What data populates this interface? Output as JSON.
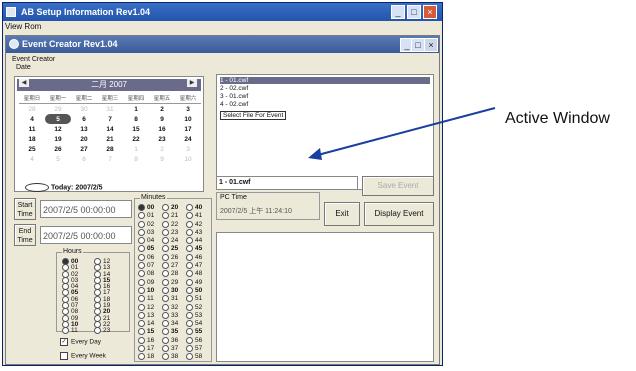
{
  "app": {
    "title": "AB Setup Information Rev1.04",
    "menu": "View Rom"
  },
  "child": {
    "title": "Event Creator Rev1.04",
    "group_label": "Event Creator",
    "date_label": "Date"
  },
  "calendar": {
    "month_title": "二月 2007",
    "weekdays": [
      "星期日",
      "星期一",
      "星期二",
      "星期三",
      "星期四",
      "星期五",
      "星期六"
    ],
    "weeks": [
      [
        "28",
        "29",
        "30",
        "31",
        "1",
        "2",
        "3"
      ],
      [
        "4",
        "5",
        "6",
        "7",
        "8",
        "9",
        "10"
      ],
      [
        "11",
        "12",
        "13",
        "14",
        "15",
        "16",
        "17"
      ],
      [
        "18",
        "19",
        "20",
        "21",
        "22",
        "23",
        "24"
      ],
      [
        "25",
        "26",
        "27",
        "28",
        "1",
        "2",
        "3"
      ],
      [
        "4",
        "5",
        "6",
        "7",
        "8",
        "9",
        "10"
      ]
    ],
    "today_label": "Today: 2007/2/5"
  },
  "start": {
    "button": "Start Time",
    "value": "2007/2/5 00:00:00"
  },
  "end": {
    "button": "End Time",
    "value": "2007/2/5 00:00:00"
  },
  "hours": {
    "label": "Hours",
    "col1": [
      "00",
      "01",
      "02",
      "03",
      "04",
      "05",
      "06",
      "07",
      "08",
      "09",
      "10",
      "11"
    ],
    "col2": [
      "12",
      "13",
      "14",
      "15",
      "16",
      "17",
      "18",
      "19",
      "20",
      "21",
      "22",
      "23"
    ]
  },
  "minutes": {
    "label": "Minutes",
    "col1": [
      "00",
      "01",
      "02",
      "03",
      "04",
      "05",
      "06",
      "07",
      "08",
      "09",
      "10",
      "11",
      "12",
      "13",
      "14",
      "15",
      "16",
      "17",
      "18"
    ],
    "col2": [
      "20",
      "21",
      "22",
      "23",
      "24",
      "25",
      "26",
      "27",
      "28",
      "29",
      "30",
      "31",
      "32",
      "33",
      "34",
      "35",
      "36",
      "37",
      "38"
    ],
    "col3": [
      "40",
      "41",
      "42",
      "43",
      "44",
      "45",
      "46",
      "47",
      "48",
      "49",
      "50",
      "51",
      "52",
      "53",
      "54",
      "55",
      "56",
      "57",
      "58"
    ]
  },
  "options": {
    "every_day": "Every Day",
    "every_week": "Every Week"
  },
  "rules_list": [
    "1 - 01.cwf",
    "2 - 02.cwf",
    "3 - 01.cwf",
    "4 - 02.cwf"
  ],
  "rules_link": "Select File For Event",
  "active_field": "1 - 01.cwf",
  "pc_time": {
    "label": "PC Time",
    "value": "2007/2/5 上午 11:24:10"
  },
  "buttons": {
    "save": "Save Event",
    "exit": "Exit",
    "display": "Display Event"
  },
  "annotation": "Active Window"
}
